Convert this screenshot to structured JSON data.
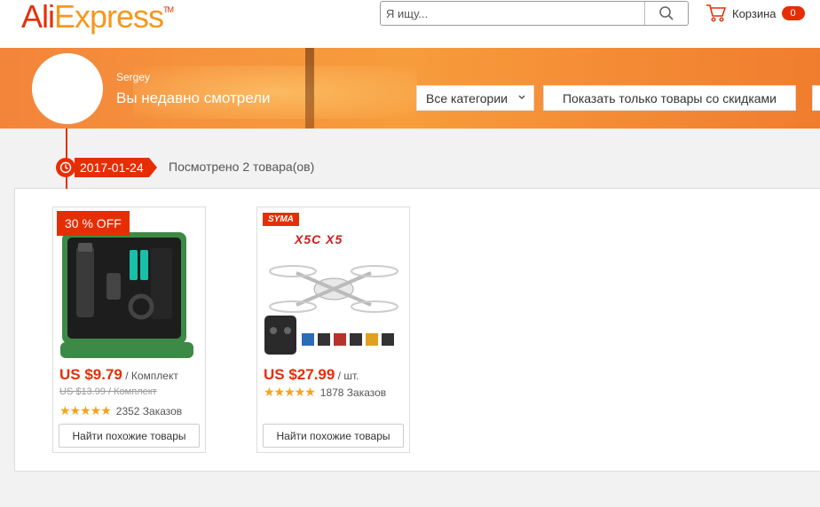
{
  "header": {
    "logo_part1": "Ali",
    "logo_part2": "Express",
    "logo_tm": "TM",
    "search_placeholder": "Я ищу...",
    "cart_label": "Корзина",
    "cart_count": "0"
  },
  "profile": {
    "username": "Sergey",
    "title": "Вы недавно смотрели"
  },
  "filters": {
    "categories_label": "Все категории",
    "discount_label": "Показать только товары со скидками"
  },
  "timeline": {
    "date": "2017-01-24",
    "viewed_text": "Посмотрено 2 товара(ов)"
  },
  "products": [
    {
      "badge": "30 % OFF",
      "price": "US $9.79",
      "unit": " / Комплект",
      "old_price": "US $13.99 / Комплект",
      "stars": "★★★★★",
      "orders": "2352 Заказов",
      "similar_label": "Найти похожие товары"
    },
    {
      "brand": "SYMA",
      "model": "X5C X5",
      "price": "US $27.99",
      "unit": " / шт.",
      "stars": "★★★★★",
      "orders": "1878 Заказов",
      "similar_label": "Найти похожие товары"
    }
  ],
  "colors": {
    "accent": "#e62e04",
    "brand_orange": "#f7971e",
    "star": "#f7a21b"
  }
}
